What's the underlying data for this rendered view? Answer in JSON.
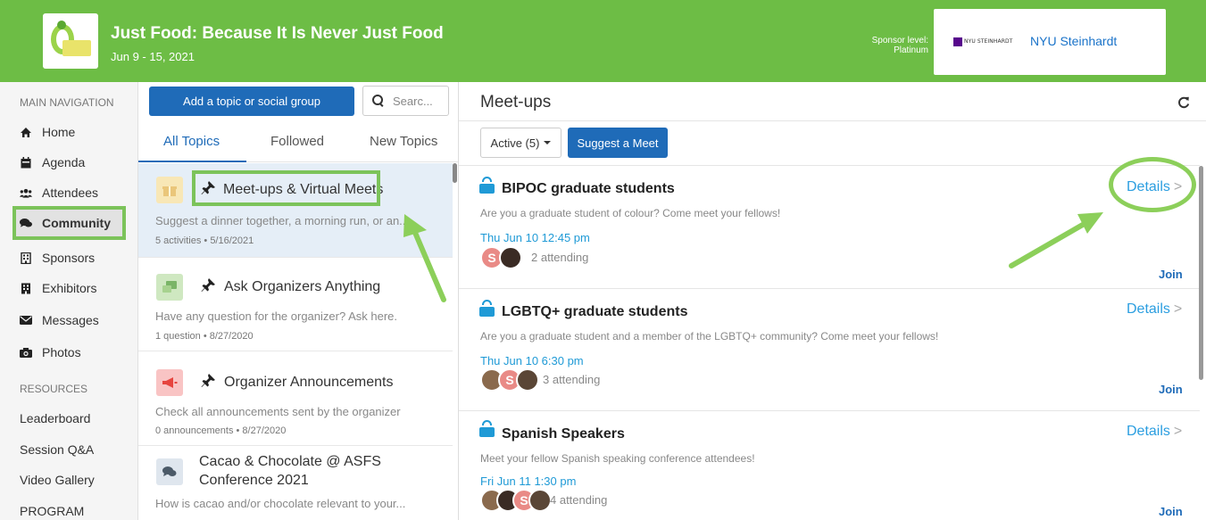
{
  "header": {
    "event_title": "Just Food: Because It Is Never Just Food",
    "event_dates": "Jun 9 - 15, 2021",
    "sponsor_level_label": "Sponsor level:",
    "sponsor_level": "Platinum",
    "sponsor_logo_text": "NYU STEINHARDT",
    "sponsor_name": "NYU Steinhardt",
    "color": "#6dbd45"
  },
  "nav": {
    "main_heading": "MAIN NAVIGATION",
    "items": [
      {
        "label": "Home",
        "icon": "home-icon"
      },
      {
        "label": "Agenda",
        "icon": "calendar-icon"
      },
      {
        "label": "Attendees",
        "icon": "users-icon"
      },
      {
        "label": "Community",
        "icon": "comments-icon",
        "active": true
      },
      {
        "label": "Sponsors",
        "icon": "building-icon"
      },
      {
        "label": "Exhibitors",
        "icon": "building-icon"
      },
      {
        "label": "Messages",
        "icon": "envelope-icon"
      },
      {
        "label": "Photos",
        "icon": "camera-icon"
      }
    ],
    "resources_heading": "RESOURCES",
    "resources": [
      "Leaderboard",
      "Session Q&A",
      "Video Gallery",
      "PROGRAM"
    ]
  },
  "topics": {
    "add_button": "Add a topic or social group",
    "search_placeholder": "Searc...",
    "tabs": [
      "All Topics",
      "Followed",
      "New Topics"
    ],
    "items": [
      {
        "title": "Meet-ups & Virtual Meets",
        "desc": "Suggest a dinner together, a morning run, or an...",
        "meta": "5 activities • 5/16/2021",
        "pinned": true
      },
      {
        "title": "Ask Organizers Anything",
        "desc": "Have any question for the organizer? Ask here.",
        "meta": "1 question • 8/27/2020",
        "pinned": true
      },
      {
        "title": "Organizer Announcements",
        "desc": "Check all announcements sent by the organizer",
        "meta": "0 announcements • 8/27/2020",
        "pinned": true
      },
      {
        "title_line1": "Cacao & Chocolate @ ASFS",
        "title_line2": "Conference 2021",
        "desc": "How is cacao and/or chocolate relevant to your...",
        "pinned": false
      }
    ]
  },
  "meetups": {
    "title": "Meet-ups",
    "filter_label": "Active (5)",
    "suggest_button": "Suggest a Meet",
    "details_label": "Details",
    "join_label": "Join",
    "items": [
      {
        "name": "BIPOC graduate students",
        "desc": "Are you a graduate student of colour? Come meet your fellows!",
        "time": "Thu Jun 10 12:45 pm",
        "attending": "2 attending"
      },
      {
        "name": "LGBTQ+ graduate students",
        "desc": "Are you a graduate student and a member of the LGBTQ+ community? Come meet your fellows!",
        "time": "Thu Jun 10 6:30 pm",
        "attending": "3 attending"
      },
      {
        "name": "Spanish Speakers",
        "desc": "Meet your fellow Spanish speaking conference attendees!",
        "time": "Fri Jun 11 1:30 pm",
        "attending": "4 attending"
      }
    ]
  },
  "colors": {
    "accent_blue": "#1f6bb8",
    "link_blue": "#2b9ee0",
    "highlight_green": "#7cc35a"
  }
}
